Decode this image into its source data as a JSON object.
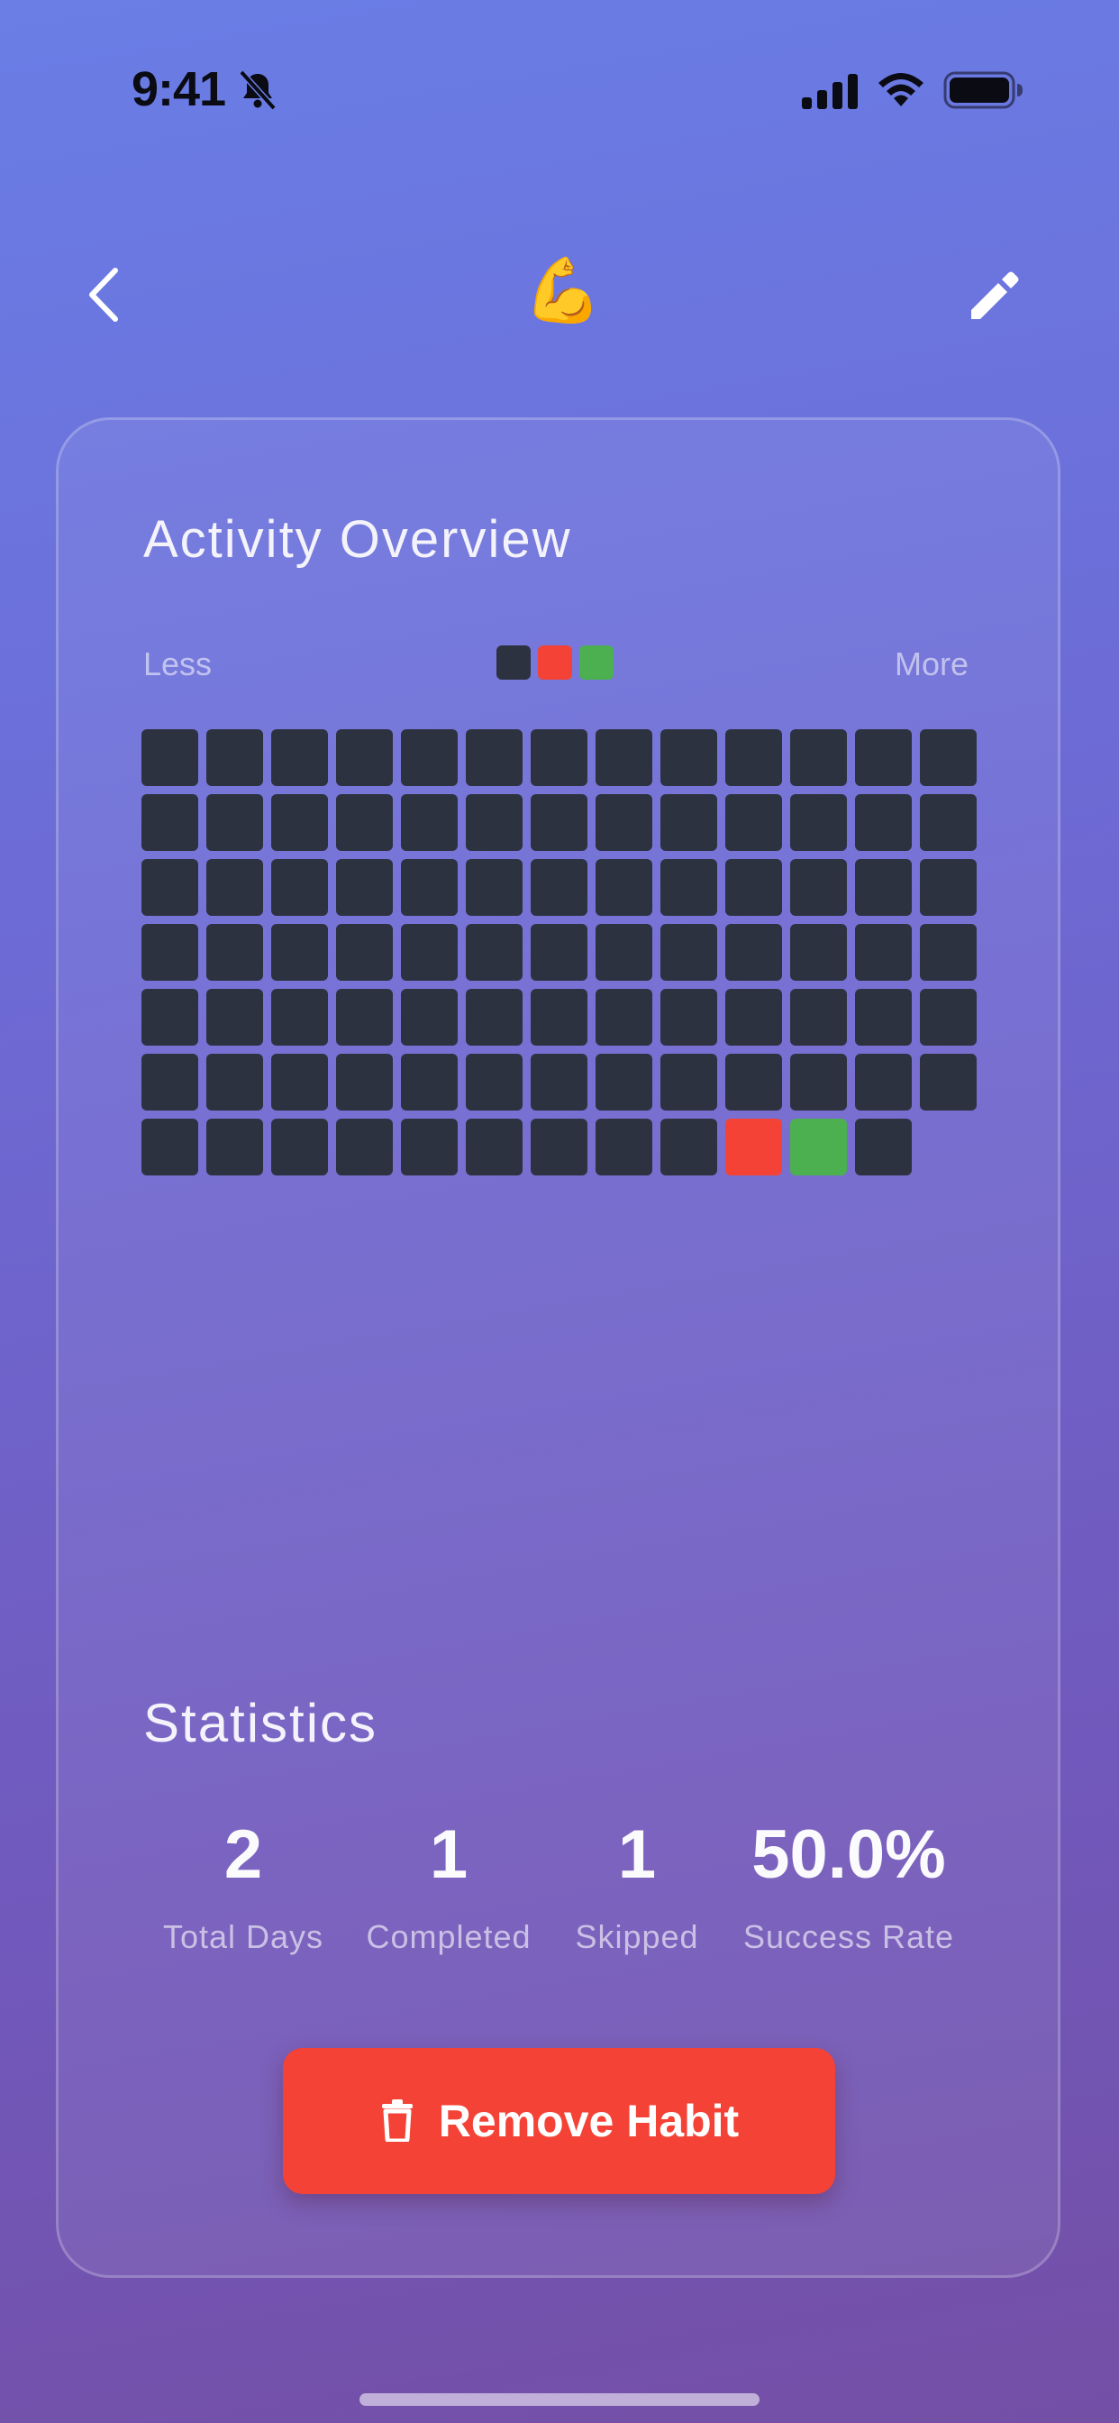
{
  "status_bar": {
    "time": "9:41",
    "icons": [
      "bell-slash-icon",
      "cellular-signal-icon",
      "wifi-icon",
      "battery-icon"
    ]
  },
  "nav": {
    "back_icon": "chevron-left-icon",
    "habit_emoji": "💪",
    "edit_icon": "pencil-icon"
  },
  "activity": {
    "title": "Activity Overview",
    "legend_less": "Less",
    "legend_more": "More",
    "legend_colors": [
      "#2d3240",
      "#f44336",
      "#4caf50"
    ],
    "grid_columns": 13,
    "cells": [
      "none",
      "none",
      "none",
      "none",
      "none",
      "none",
      "none",
      "none",
      "none",
      "none",
      "none",
      "none",
      "none",
      "none",
      "none",
      "none",
      "none",
      "none",
      "none",
      "none",
      "none",
      "none",
      "none",
      "none",
      "none",
      "none",
      "none",
      "none",
      "none",
      "none",
      "none",
      "none",
      "none",
      "none",
      "none",
      "none",
      "none",
      "none",
      "none",
      "none",
      "none",
      "none",
      "none",
      "none",
      "none",
      "none",
      "none",
      "none",
      "none",
      "none",
      "none",
      "none",
      "none",
      "none",
      "none",
      "none",
      "none",
      "none",
      "none",
      "none",
      "none",
      "none",
      "none",
      "none",
      "none",
      "none",
      "none",
      "none",
      "none",
      "none",
      "none",
      "none",
      "none",
      "none",
      "none",
      "none",
      "none",
      "none",
      "none",
      "none",
      "none",
      "none",
      "none",
      "none",
      "none",
      "none",
      "none",
      "skipped",
      "completed",
      "none"
    ],
    "cell_colors": {
      "none": "#2d3240",
      "skipped": "#f44336",
      "completed": "#4caf50"
    }
  },
  "statistics": {
    "title": "Statistics",
    "items": [
      {
        "value": "2",
        "label": "Total Days"
      },
      {
        "value": "1",
        "label": "Completed"
      },
      {
        "value": "1",
        "label": "Skipped"
      },
      {
        "value": "50.0%",
        "label": "Success Rate"
      }
    ]
  },
  "actions": {
    "remove_label": "Remove Habit",
    "remove_icon": "trash-icon",
    "remove_color": "#f44336"
  }
}
